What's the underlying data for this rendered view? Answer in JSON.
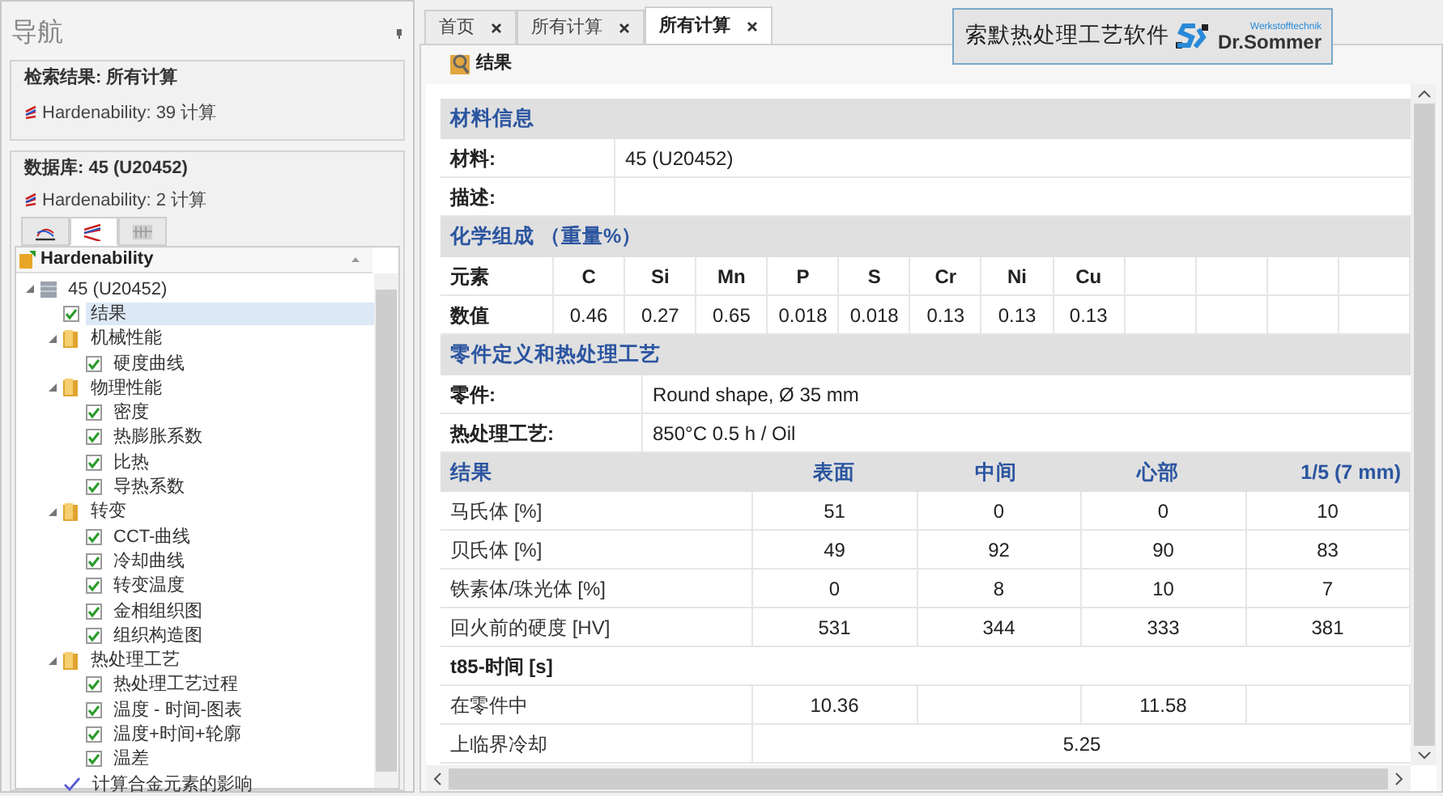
{
  "navigation": {
    "title": "导航",
    "search_result": {
      "heading": "检索结果: 所有计算",
      "item": "Hardenability: 39 计算"
    },
    "database": {
      "heading": "数据库: 45 (U20452)",
      "item": "Hardenability: 2 计算"
    },
    "icon_tabs": [
      {
        "selected": false
      },
      {
        "selected": true
      },
      {
        "selected": false
      }
    ],
    "tree": {
      "header": "Hardenability",
      "items": [
        {
          "kind": "material",
          "label": "45 (U20452)",
          "expanded": true,
          "children": [
            {
              "kind": "check",
              "label": "结果",
              "checked": true,
              "selected": true
            },
            {
              "kind": "folder",
              "label": "机械性能",
              "expanded": true,
              "children": [
                {
                  "kind": "check",
                  "label": "硬度曲线",
                  "checked": true,
                  "selected": false
                }
              ]
            },
            {
              "kind": "folder",
              "label": "物理性能",
              "expanded": true,
              "children": [
                {
                  "kind": "check",
                  "label": "密度",
                  "checked": true,
                  "selected": false
                },
                {
                  "kind": "check",
                  "label": "热膨胀系数",
                  "checked": true,
                  "selected": false
                },
                {
                  "kind": "check",
                  "label": "比热",
                  "checked": true,
                  "selected": false
                },
                {
                  "kind": "check",
                  "label": "导热系数",
                  "checked": true,
                  "selected": false
                }
              ]
            },
            {
              "kind": "folder",
              "label": "转变",
              "expanded": true,
              "children": [
                {
                  "kind": "check",
                  "label": "CCT-曲线",
                  "checked": true,
                  "selected": false
                },
                {
                  "kind": "check",
                  "label": "冷却曲线",
                  "checked": true,
                  "selected": false
                },
                {
                  "kind": "check",
                  "label": "转变温度",
                  "checked": true,
                  "selected": false
                },
                {
                  "kind": "check",
                  "label": "金相组织图",
                  "checked": true,
                  "selected": false
                },
                {
                  "kind": "check",
                  "label": "组织构造图",
                  "checked": true,
                  "selected": false
                }
              ]
            },
            {
              "kind": "folder",
              "label": "热处理工艺",
              "expanded": true,
              "children": [
                {
                  "kind": "check",
                  "label": "热处理工艺过程",
                  "checked": true,
                  "selected": false
                },
                {
                  "kind": "check",
                  "label": "温度 - 时间-图表",
                  "checked": true,
                  "selected": false
                },
                {
                  "kind": "check",
                  "label": "温度+时间+轮廓",
                  "checked": true,
                  "selected": false
                },
                {
                  "kind": "check",
                  "label": "温差",
                  "checked": true,
                  "selected": false
                }
              ]
            },
            {
              "kind": "calc",
              "label": "计算合金元素的影响"
            }
          ]
        }
      ]
    }
  },
  "tabs": [
    {
      "label": "首页",
      "selected": false
    },
    {
      "label": "所有计算",
      "selected": false
    },
    {
      "label": "所有计算",
      "selected": true
    }
  ],
  "logo": {
    "caption": "索默热处理工艺软件",
    "brand": "Dr.Sommer",
    "tagline": "Werkstofftechnik"
  },
  "panel_title": "结果",
  "material_info": {
    "heading": "材料信息",
    "fields": [
      {
        "label": "材料:",
        "value": "45 (U20452)"
      },
      {
        "label": "描述:"
      }
    ]
  },
  "chemistry": {
    "heading": "化学组成 （重量%）",
    "element_label": "元素",
    "value_label": "数值",
    "elements": [
      {
        "symbol": "C",
        "value": "0.46"
      },
      {
        "symbol": "Si",
        "value": "0.27"
      },
      {
        "symbol": "Mn",
        "value": "0.65"
      },
      {
        "symbol": "P",
        "value": "0.018"
      },
      {
        "symbol": "S",
        "value": "0.018"
      },
      {
        "symbol": "Cr",
        "value": "0.13"
      },
      {
        "symbol": "Ni",
        "value": "0.13"
      },
      {
        "symbol": "Cu",
        "value": "0.13"
      }
    ]
  },
  "part": {
    "heading": "零件定义和热处理工艺",
    "fields": [
      {
        "label": "零件:",
        "value": "Round shape, Ø 35 mm"
      },
      {
        "label": "热处理工艺:",
        "value": "850°C 0.5 h / Oil"
      }
    ]
  },
  "results": {
    "columns": [
      "结果",
      "表面",
      "中间",
      "心部",
      "1/5 (7 mm)"
    ],
    "rows": [
      {
        "cells": [
          "马氏体 [%]",
          "51",
          "0",
          "0",
          "10"
        ]
      },
      {
        "cells": [
          "贝氏体 [%]",
          "49",
          "92",
          "90",
          "83"
        ]
      },
      {
        "cells": [
          "铁素体/珠光体 [%]",
          "0",
          "8",
          "10",
          "7"
        ]
      },
      {
        "cells": [
          "回火前的硬度 [HV]",
          "531",
          "344",
          "333",
          "381"
        ]
      }
    ]
  },
  "t85": {
    "heading": "t85-时间 [s]",
    "rows": [
      {
        "kind": "split",
        "label": "在零件中",
        "cells": [
          "10.36",
          null,
          "11.58",
          null
        ]
      },
      {
        "kind": "merged",
        "label": "上临界冷却",
        "value": "5.25"
      }
    ]
  }
}
